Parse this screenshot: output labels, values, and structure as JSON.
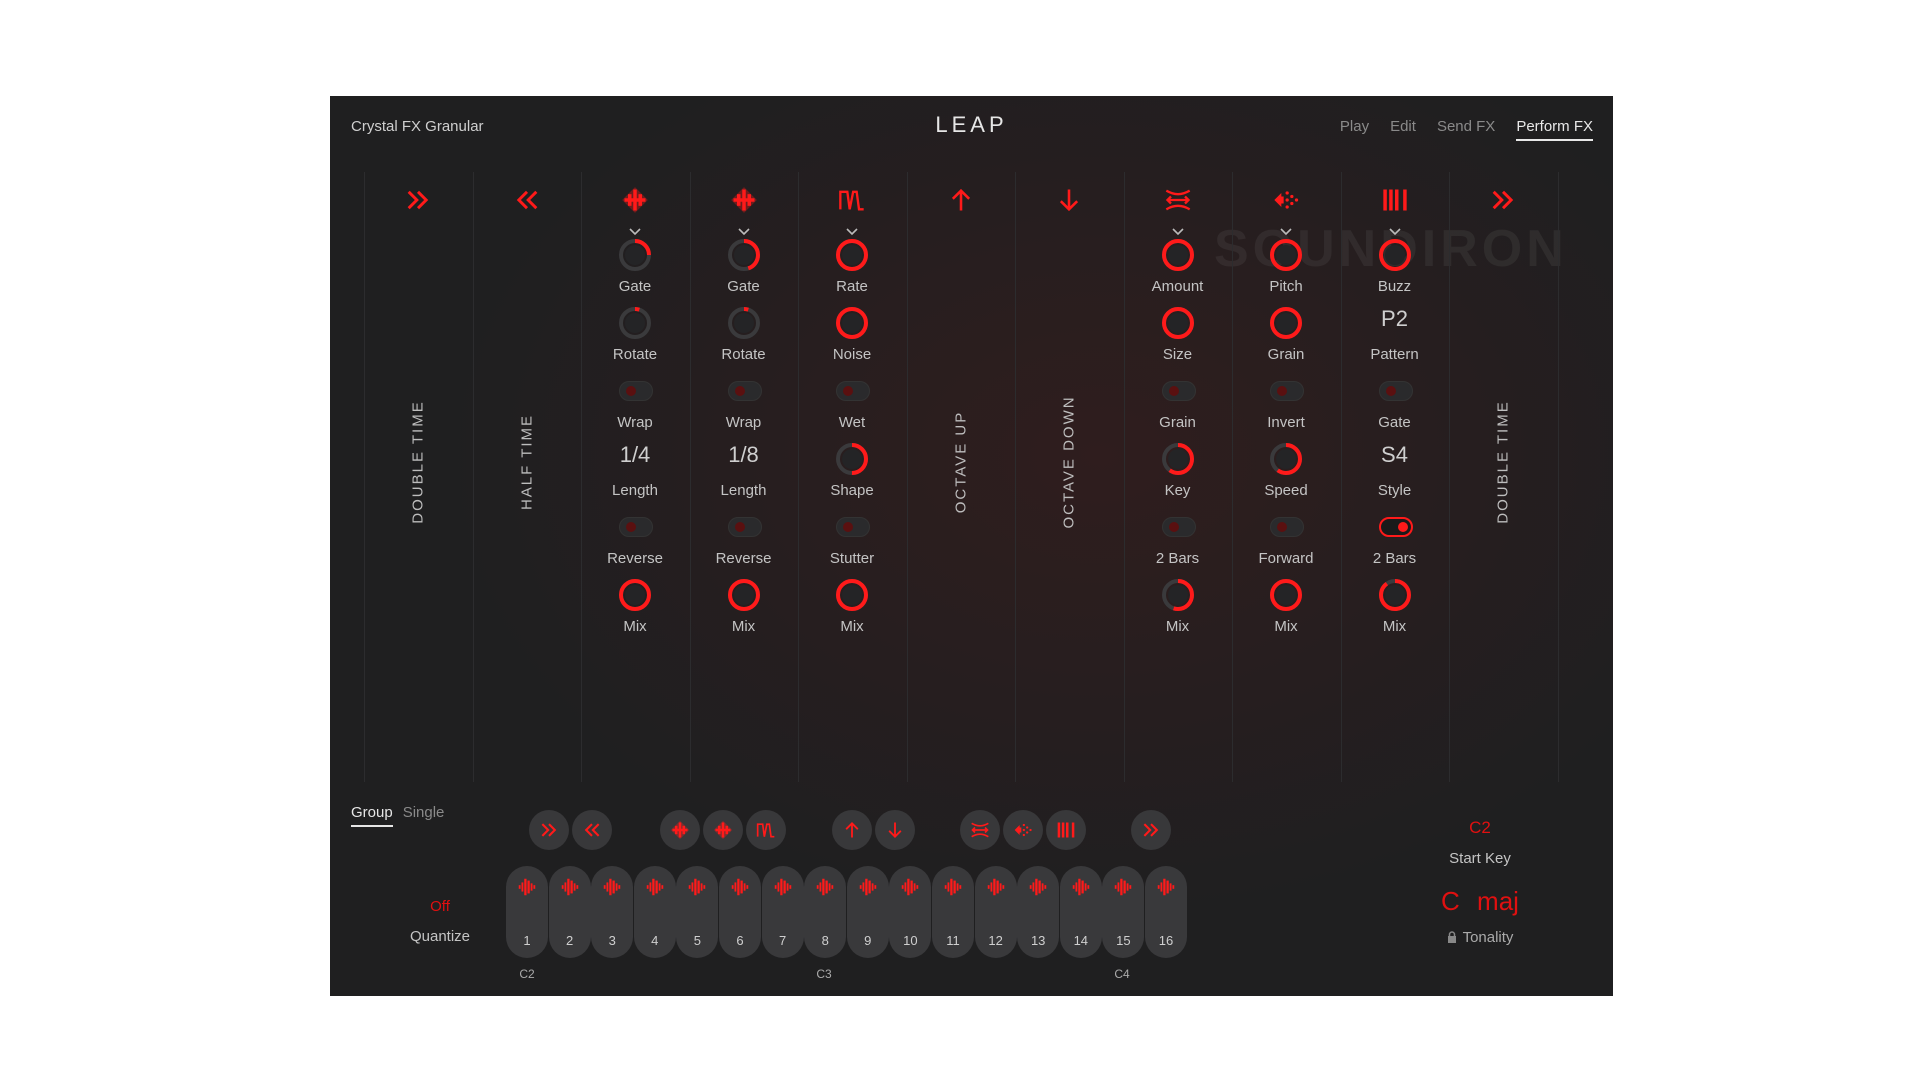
{
  "header": {
    "instrument": "Crystal FX Granular",
    "logo": "LEAP",
    "nav": [
      "Play",
      "Edit",
      "Send FX",
      "Perform FX"
    ],
    "nav_active": "Perform FX"
  },
  "watermark": "SOUNDIRON",
  "colors": {
    "accent": "#ff1a1a",
    "panel": "#1f1f20",
    "pad": "#39393b"
  },
  "columns": [
    {
      "type": "vertical",
      "icon": "double-chevron-right-icon",
      "vlabel": "DOUBLE  TIME"
    },
    {
      "type": "vertical",
      "icon": "double-chevron-left-icon",
      "vlabel": "HALF  TIME"
    },
    {
      "type": "controls",
      "icon": "stutter-diamond-icon",
      "dropdown": true,
      "rows": [
        {
          "kind": "knob",
          "label": "Gate",
          "level": 0.25
        },
        {
          "kind": "knob",
          "label": "Rotate",
          "level": 0.05
        },
        {
          "kind": "toggle",
          "label": "Wrap",
          "on": false
        },
        {
          "kind": "value",
          "label": "Length",
          "value": "1/4"
        },
        {
          "kind": "toggle",
          "label": "Reverse",
          "on": false
        },
        {
          "kind": "knob",
          "label": "Mix",
          "level": 1.0
        }
      ]
    },
    {
      "type": "controls",
      "icon": "stutter-diamond-icon",
      "dropdown": true,
      "rows": [
        {
          "kind": "knob",
          "label": "Gate",
          "level": 0.45
        },
        {
          "kind": "knob",
          "label": "Rotate",
          "level": 0.05
        },
        {
          "kind": "toggle",
          "label": "Wrap",
          "on": false
        },
        {
          "kind": "value",
          "label": "Length",
          "value": "1/8"
        },
        {
          "kind": "toggle",
          "label": "Reverse",
          "on": false
        },
        {
          "kind": "knob",
          "label": "Mix",
          "level": 1.0
        }
      ]
    },
    {
      "type": "controls",
      "icon": "modulation-wave-icon",
      "dropdown": true,
      "rows": [
        {
          "kind": "knob",
          "label": "Rate",
          "level": 1.0
        },
        {
          "kind": "knob",
          "label": "Noise",
          "level": 1.0
        },
        {
          "kind": "toggle",
          "label": "Wet",
          "on": false
        },
        {
          "kind": "knob",
          "label": "Shape",
          "level": 0.5
        },
        {
          "kind": "toggle",
          "label": "Stutter",
          "on": false
        },
        {
          "kind": "knob",
          "label": "Mix",
          "level": 1.0
        }
      ]
    },
    {
      "type": "vertical",
      "icon": "arrow-up-icon",
      "vlabel": "OCTAVE  UP"
    },
    {
      "type": "vertical",
      "icon": "arrow-down-icon",
      "vlabel": "OCTAVE  DOWN"
    },
    {
      "type": "controls",
      "icon": "compress-arrows-icon",
      "dropdown": true,
      "rows": [
        {
          "kind": "knob",
          "label": "Amount",
          "level": 1.0
        },
        {
          "kind": "knob",
          "label": "Size",
          "level": 1.0
        },
        {
          "kind": "toggle",
          "label": "Grain",
          "on": false
        },
        {
          "kind": "knob",
          "label": "Key",
          "level": 0.6
        },
        {
          "kind": "toggle",
          "label": "2 Bars",
          "on": false
        },
        {
          "kind": "knob",
          "label": "Mix",
          "level": 0.55
        }
      ]
    },
    {
      "type": "controls",
      "icon": "scatter-left-icon",
      "dropdown": true,
      "rows": [
        {
          "kind": "knob",
          "label": "Pitch",
          "level": 1.0
        },
        {
          "kind": "knob",
          "label": "Grain",
          "level": 1.0
        },
        {
          "kind": "toggle",
          "label": "Invert",
          "on": false
        },
        {
          "kind": "knob",
          "label": "Speed",
          "level": 0.6
        },
        {
          "kind": "toggle",
          "label": "Forward",
          "on": false
        },
        {
          "kind": "knob",
          "label": "Mix",
          "level": 1.0
        }
      ]
    },
    {
      "type": "controls",
      "icon": "gate-bars-icon",
      "dropdown": true,
      "rows": [
        {
          "kind": "knob",
          "label": "Buzz",
          "level": 1.0
        },
        {
          "kind": "value",
          "label": "Pattern",
          "value": "P2"
        },
        {
          "kind": "toggle",
          "label": "Gate",
          "on": false
        },
        {
          "kind": "value",
          "label": "Style",
          "value": "S4"
        },
        {
          "kind": "toggle",
          "label": "2 Bars",
          "on": true
        },
        {
          "kind": "knob",
          "label": "Mix",
          "level": 0.9
        }
      ]
    },
    {
      "type": "vertical",
      "icon": "double-chevron-right-icon",
      "vlabel": "DOUBLE  TIME"
    }
  ],
  "bottom": {
    "mode_tabs": [
      "Group",
      "Single"
    ],
    "mode_active": "Group",
    "fx_buttons": [
      "double-chevron-right-icon",
      "double-chevron-left-icon",
      "stutter-diamond-icon",
      "stutter-diamond-icon",
      "modulation-wave-icon",
      "arrow-up-icon",
      "arrow-down-icon",
      "compress-arrows-icon",
      "scatter-left-icon",
      "gate-bars-icon",
      "double-chevron-right-icon"
    ],
    "quantize": {
      "value": "Off",
      "label": "Quantize"
    },
    "pads": [
      "1",
      "2",
      "3",
      "4",
      "5",
      "6",
      "7",
      "8",
      "9",
      "10",
      "11",
      "12",
      "13",
      "14",
      "15",
      "16"
    ],
    "pad_icon": "waveform-icon",
    "octave_labels": [
      "C2",
      "C3",
      "C4"
    ],
    "start_key": {
      "value": "C2",
      "label": "Start Key"
    },
    "tonality": {
      "value": "C  maj",
      "label": "Tonality",
      "icon": "lock-icon"
    }
  }
}
